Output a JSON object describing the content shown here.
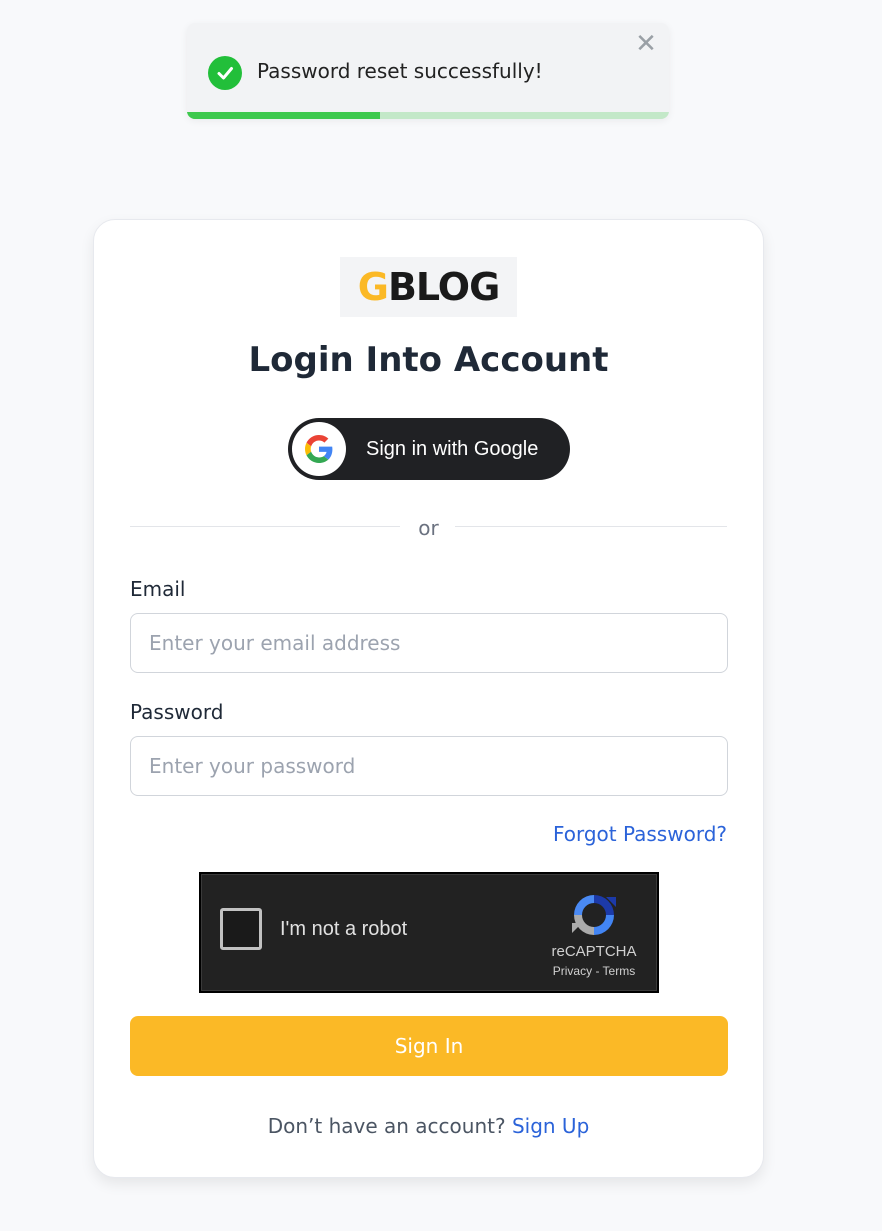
{
  "toast": {
    "message": "Password reset successfully!",
    "close_glyph": "✕",
    "progress": 0.4,
    "icon": "check-circle-icon",
    "color_success": "#22bf3a"
  },
  "brand": {
    "logo_g": "G",
    "logo_rest": "BLOG",
    "accent": "#fbb926"
  },
  "login": {
    "title": "Login Into Account",
    "google_button": "Sign in with Google",
    "divider": "or",
    "email_label": "Email",
    "email_placeholder": "Enter your email address",
    "email_value": "",
    "password_label": "Password",
    "password_placeholder": "Enter your password",
    "password_value": "",
    "forgot_link": "Forgot Password?",
    "submit_button": "Sign In",
    "signup_prompt": "Don’t have an account?",
    "signup_link": "Sign Up",
    "link_color": "#2b63d9"
  },
  "captcha": {
    "label": "I'm not a robot",
    "brand": "reCAPTCHA",
    "links": "Privacy - Terms",
    "checked": false
  }
}
